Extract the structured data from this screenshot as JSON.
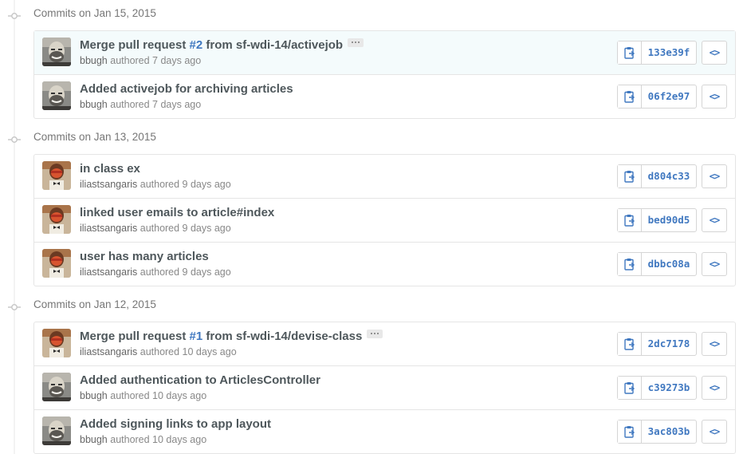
{
  "groups": [
    {
      "title": "Commits on Jan 15, 2015",
      "commits": [
        {
          "title_prefix": "Merge pull request ",
          "pr": "#2",
          "title_suffix": " from sf-wdi-14/activejob",
          "title": "",
          "author": "bbugh",
          "meta": " authored 7 days ago",
          "sha": "133e39f",
          "avatar": "bbugh",
          "has_ellipsis": true,
          "highlight": true
        },
        {
          "title": "Added activejob for archiving articles",
          "author": "bbugh",
          "meta": " authored 7 days ago",
          "sha": "06f2e97",
          "avatar": "bbugh"
        }
      ]
    },
    {
      "title": "Commits on Jan 13, 2015",
      "commits": [
        {
          "title": "in class ex",
          "author": "iliastsangaris",
          "meta": " authored 9 days ago",
          "sha": "d804c33",
          "avatar": "iliastsangaris"
        },
        {
          "title": "linked user emails to article#index",
          "author": "iliastsangaris",
          "meta": " authored 9 days ago",
          "sha": "bed90d5",
          "avatar": "iliastsangaris"
        },
        {
          "title": "user has many articles",
          "author": "iliastsangaris",
          "meta": " authored 9 days ago",
          "sha": "dbbc08a",
          "avatar": "iliastsangaris"
        }
      ]
    },
    {
      "title": "Commits on Jan 12, 2015",
      "commits": [
        {
          "title_prefix": "Merge pull request ",
          "pr": "#1",
          "title_suffix": " from sf-wdi-14/devise-class",
          "title": "",
          "author": "iliastsangaris",
          "meta": " authored 10 days ago",
          "sha": "2dc7178",
          "avatar": "iliastsangaris",
          "has_ellipsis": true
        },
        {
          "title": "Added authentication to ArticlesController",
          "author": "bbugh",
          "meta": " authored 10 days ago",
          "sha": "c39273b",
          "avatar": "bbugh"
        },
        {
          "title": "Added signing links to app layout",
          "author": "bbugh",
          "meta": " authored 10 days ago",
          "sha": "3ac803b",
          "avatar": "bbugh"
        }
      ]
    }
  ],
  "browse_label": "<>",
  "icons": {
    "copy": "clippy-icon",
    "browse": "code-icon",
    "timeline": "git-commit-icon",
    "more": "ellipsis-icon"
  },
  "colors": {
    "link": "#4078c0",
    "title": "#4e575b",
    "meta": "#888888",
    "border": "#e5e5e5",
    "highlight_row": "#f4fbfc"
  }
}
